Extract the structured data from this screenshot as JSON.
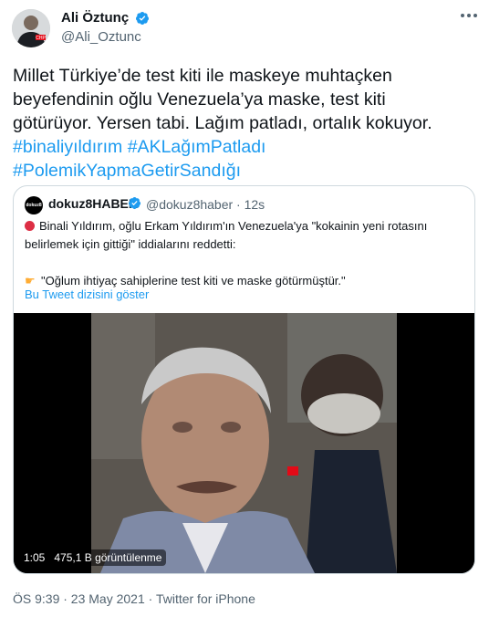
{
  "author": {
    "display_name": "Ali Öztunç",
    "handle": "@Ali_Oztunc"
  },
  "tweet": {
    "lines": [
      "Millet Türkiye’de test kiti ile maskeye muhtaçken",
      "beyefendinin oğlu Venezuela’ya maske, test kiti",
      "götürüyor. Yersen tabi. Lağım patladı, ortalık kokuyor."
    ],
    "hashtags_line1": "#binaliyıldırım #AKLağımPatladı",
    "hashtags_line2": "#PolemikYapmaGetirSandığı"
  },
  "quoted_tweet": {
    "avatar_text": "dokuz8",
    "display_name": "dokuz8HABER",
    "handle_time": "@dokuz8haber · 12s",
    "body_line1": "Binali Yıldırım, oğlu Erkam Yıldırım'ın Venezuela'ya \"kokainin yeni rotasını",
    "body_line2": "belirlemek için gittiği\" iddialarını reddetti:",
    "quote_line": "\"Oğlum ihtiyaç sahiplerine test kiti ve maske götürmüştür.\"",
    "show_thread": "Bu Tweet dizisini göster",
    "video_duration": "1:05",
    "video_views": "475,1 B görüntülenme"
  },
  "footer": {
    "meta": "ÖS 9:39 · 23 May 2021 · Twitter for iPhone"
  },
  "colors": {
    "accent": "#1d9bf0",
    "text": "#0f1419",
    "secondary": "#536471",
    "border": "#cfd9de"
  }
}
